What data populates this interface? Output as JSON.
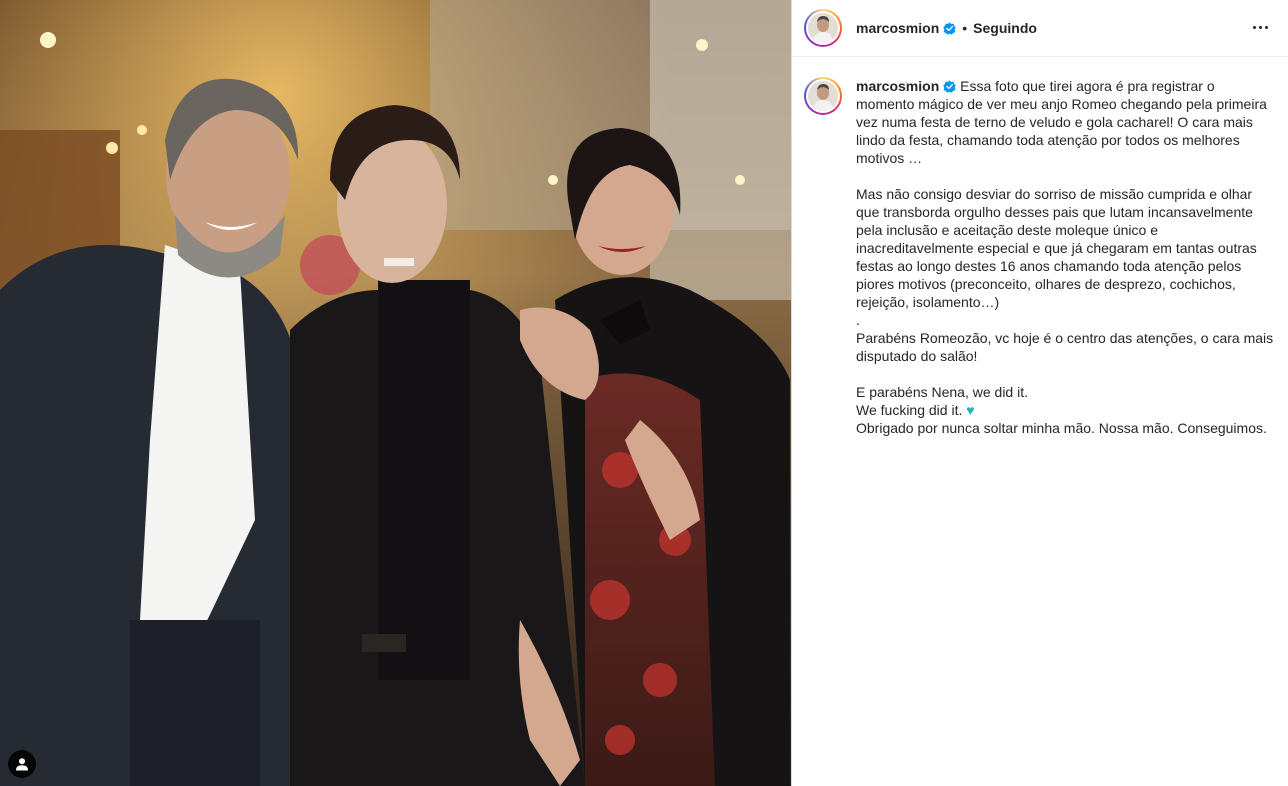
{
  "post": {
    "username": "marcosmion",
    "follow_status": "Seguindo",
    "separator": "•",
    "caption_lines": [
      "Essa foto que tirei agora é pra registrar o momento mágico de ver meu anjo Romeo chegando pela primeira vez numa festa de terno de veludo e gola cacharel! O cara mais lindo da festa, chamando toda atenção por todos os melhores motivos …",
      "",
      "Mas não consigo desviar do sorriso de missão cumprida e olhar que transborda orgulho desses pais que lutam incansavelmente pela inclusão e aceitação deste moleque único e inacreditavelmente especial e que já chegaram em tantas outras festas ao longo destes 16 anos chamando toda atenção pelos piores motivos (preconceito, olhares de desprezo, cochichos, rejeição, isolamento…)",
      ".",
      "Parabéns Romeozão, vc hoje é o centro das atenções, o cara mais disputado do salão!",
      "",
      "E parabéns Nena, we did it.",
      "We fucking did it.",
      "Obrigado por nunca soltar minha mão. Nossa mão. Conseguimos."
    ],
    "heart_emoji": "♥"
  },
  "icons": {
    "verified": "verified-badge-icon",
    "more": "more-options-icon",
    "tag": "user-tag-icon"
  },
  "colors": {
    "verified_blue": "#0095f6",
    "heart": "#23b5b5"
  }
}
